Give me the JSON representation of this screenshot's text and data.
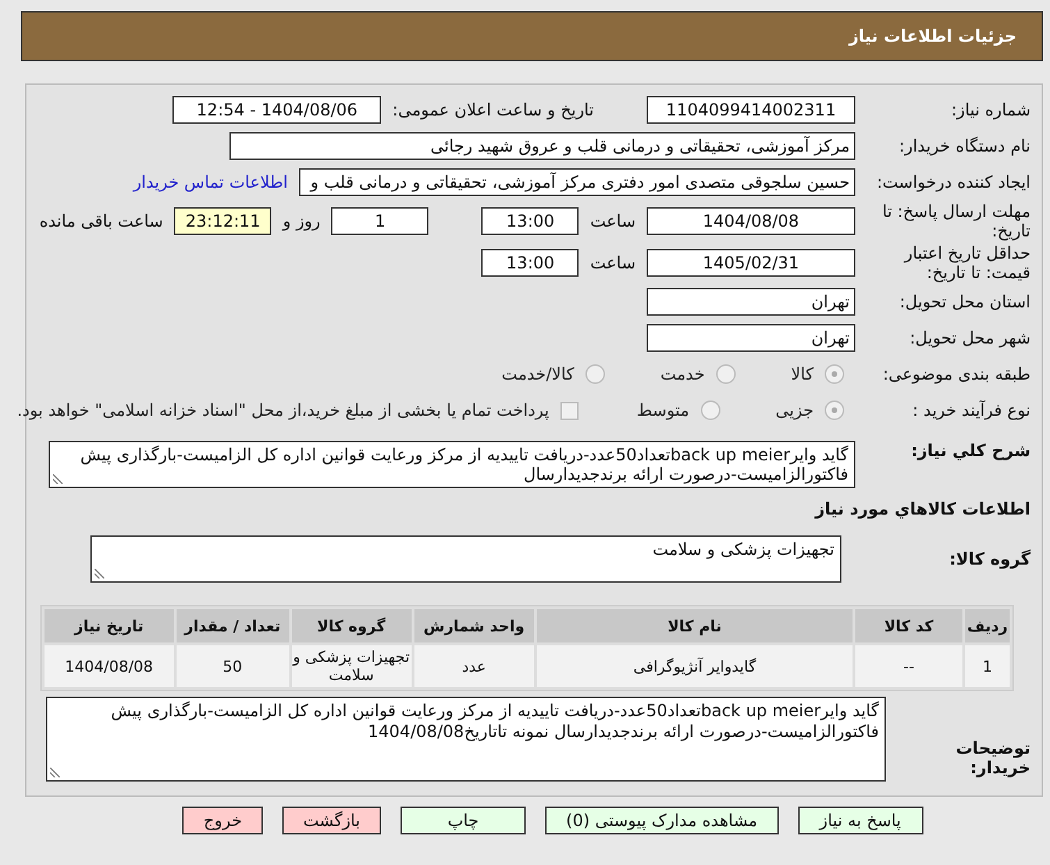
{
  "header": {
    "title": "جزئیات اطلاعات نیاز"
  },
  "need_number": {
    "label": "شماره نیاز:",
    "value": "1104099414002311"
  },
  "announce": {
    "label": "تاریخ و ساعت اعلان عمومی:",
    "value": "1404/08/06 - 12:54"
  },
  "buyer_org": {
    "label": "نام دستگاه خریدار:",
    "value": "مرکز آموزشی، تحقیقاتی و درمانی قلب و عروق شهید رجائی"
  },
  "requester": {
    "label": "ایجاد کننده درخواست:",
    "value": "حسین سلجوقی متصدی امور دفتری مرکز آموزشی، تحقیقاتی و درمانی قلب و",
    "link": "اطلاعات تماس خریدار"
  },
  "deadline": {
    "label": "مهلت ارسال پاسخ: تا تاریخ:",
    "date": "1404/08/08",
    "time_label": "ساعت",
    "time": "13:00",
    "days": "1",
    "days_label": "روز و",
    "remaining": "23:12:11",
    "remaining_label": "ساعت باقی مانده"
  },
  "validity": {
    "label": "حداقل تاریخ اعتبار قیمت: تا تاریخ:",
    "date": "1405/02/31",
    "time_label": "ساعت",
    "time": "13:00"
  },
  "province": {
    "label": "استان محل تحویل:",
    "value": "تهران"
  },
  "city": {
    "label": "شهر محل تحویل:",
    "value": "تهران"
  },
  "category": {
    "label": "طبقه بندی موضوعی:",
    "options": [
      {
        "label": "کالا",
        "selected": true
      },
      {
        "label": "خدمت",
        "selected": false
      },
      {
        "label": "کالا/خدمت",
        "selected": false
      }
    ]
  },
  "process": {
    "label": "نوع فرآیند خرید :",
    "options": [
      {
        "label": "جزیی",
        "selected": true
      },
      {
        "label": "متوسط",
        "selected": false
      }
    ],
    "payment": {
      "label": "پرداخت تمام یا بخشی از مبلغ خرید،از محل \"اسناد خزانه اسلامی\" خواهد بود.",
      "checked": false
    }
  },
  "description": {
    "label": "شرح کلي نياز:",
    "value": "گاید وایرback up meierتعداد50عدد-دریافت تاییدیه از مرکز ورعایت قوانین اداره کل الزامیست-بارگذاری پیش فاکتورالزامیست-درصورت ارائه برندجدیدارسال"
  },
  "goods_heading": "اطلاعات كالاهاي مورد نياز",
  "goods_group": {
    "label": "گروه کالا:",
    "value": "تجهیزات پزشکی و سلامت"
  },
  "table": {
    "columns": [
      "ردیف",
      "کد کالا",
      "نام کالا",
      "واحد شمارش",
      "گروه کالا",
      "تعداد / مقدار",
      "تاریخ نیاز"
    ],
    "rows": [
      [
        "1",
        "--",
        "گایدوایر آنژیوگرافی",
        "عدد",
        "تجهیزات پزشکی و سلامت",
        "50",
        "1404/08/08"
      ]
    ]
  },
  "buyer_notes": {
    "label": "توضیحات خریدار:",
    "value": "گاید وایرback up meierتعداد50عدد-دریافت تاییدیه از مرکز ورعایت قوانین اداره کل الزامیست-بارگذاری پیش فاکتورالزامیست-درصورت ارائه برندجدیدارسال نمونه تاتاریخ1404/08/08"
  },
  "buttons": [
    {
      "label": "پاسخ به نیاز",
      "kind": "action"
    },
    {
      "label": "مشاهده مدارک پیوستی (0)",
      "kind": "action"
    },
    {
      "label": "چاپ",
      "kind": "action"
    },
    {
      "label": "بازگشت",
      "kind": "exit"
    },
    {
      "label": "خروج",
      "kind": "exit"
    }
  ]
}
